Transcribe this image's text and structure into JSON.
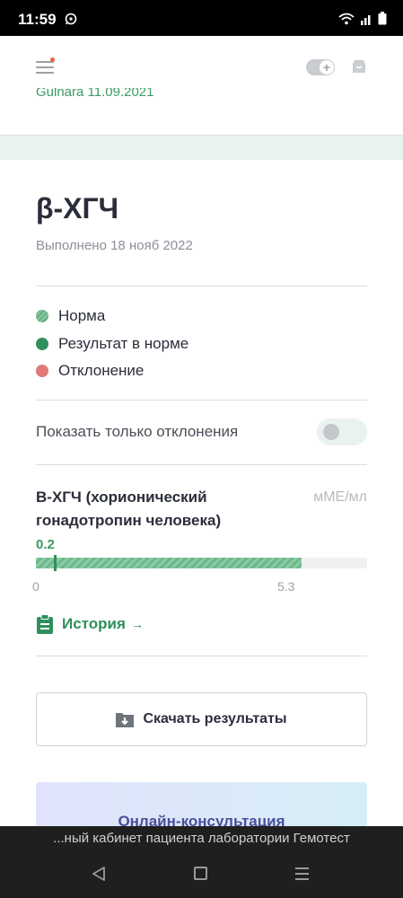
{
  "status_bar": {
    "time": "11:59",
    "icons": [
      "whatsapp-icon",
      "wifi-icon",
      "signal-icon",
      "battery-icon"
    ]
  },
  "header": {
    "icons": [
      "menu-icon",
      "add-toggle-icon",
      "cart-icon"
    ],
    "notification_color": "#e8643c"
  },
  "truncated_link": "Gulnara 11.09.2021",
  "test": {
    "title": "β-ХГЧ",
    "completed": "Выполнено 18 нояб 2022"
  },
  "legend": {
    "norm": "Норма",
    "in_norm": "Результат в норме",
    "deviation": "Отклонение",
    "colors": {
      "norm": "#6cb88a",
      "in_norm": "#2f8f5b",
      "deviation": "#e07a7a"
    }
  },
  "filter": {
    "label": "Показать только отклонения",
    "enabled": false
  },
  "analyte": {
    "name": "В-ХГЧ (хорионический гонадотропин человека)",
    "unit": "мМЕ/мл",
    "value": "0.2",
    "value_num": 0.2,
    "ref_min": "0",
    "ref_max": "5.3",
    "ref_max_num": 5.3,
    "scale_max_num": 6.6
  },
  "history": {
    "label": "История",
    "arrow": "→"
  },
  "download": {
    "label": "Скачать результаты"
  },
  "consult": {
    "label": "Онлайн-консультация"
  },
  "bottom_caption": "...ный кабинет пациента лаборатории Гемотест",
  "accent_color": "#2f8f5b"
}
